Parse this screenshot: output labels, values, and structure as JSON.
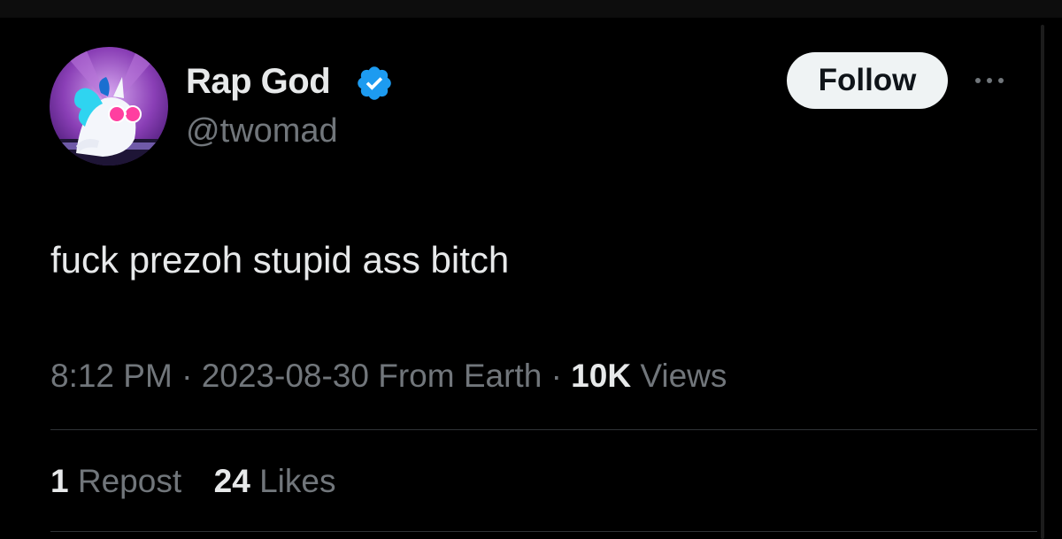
{
  "user": {
    "display_name": "Rap God",
    "handle": "@twomad",
    "verified": true,
    "verified_color": "#1d9bf0"
  },
  "actions": {
    "follow_label": "Follow",
    "more_icon": "more-horizontal-icon"
  },
  "tweet": {
    "text": "fuck prezoh stupid ass bitch",
    "time": "8:12 PM",
    "date": "2023-08-30",
    "source": "From Earth",
    "views_count": "10K",
    "views_label": "Views",
    "separator": "·"
  },
  "stats": {
    "reposts_count": "1",
    "reposts_label": "Repost",
    "likes_count": "24",
    "likes_label": "Likes"
  },
  "colors": {
    "background": "#000000",
    "text_primary": "#e7e9ea",
    "text_secondary": "#71767b",
    "divider": "#2f3336",
    "follow_bg": "#eff3f4"
  }
}
